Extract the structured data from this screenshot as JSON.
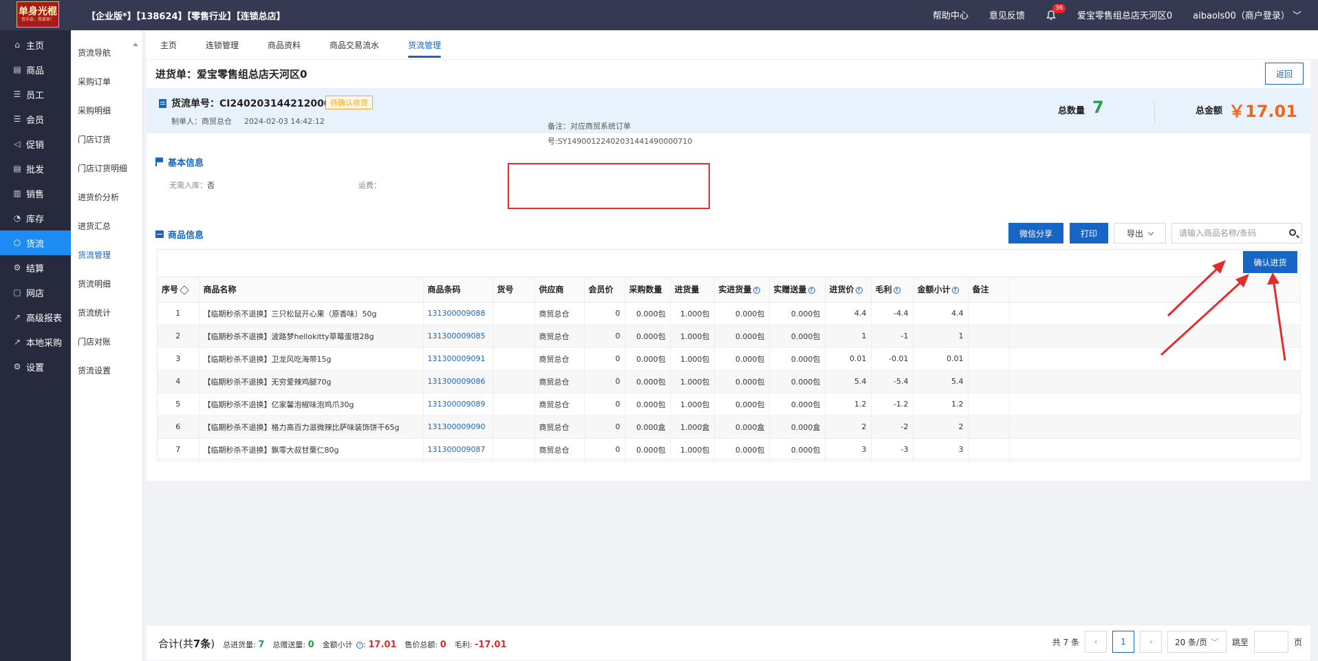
{
  "topbar": {
    "logo_text": "单身光棍",
    "logo_sub": "音乐会，我爱家！",
    "title": "【企业版*】【138624】【零售行业】【连锁总店】",
    "help": "帮助中心",
    "feedback": "意见反馈",
    "notifications": "36",
    "store": "爱宝零售组总店天河区0",
    "user": "aibaols00（商户登录）"
  },
  "leftnav": {
    "items": [
      {
        "label": "主页",
        "icon": "home-icon",
        "glyph": "⌂"
      },
      {
        "label": "商品",
        "icon": "product-icon",
        "glyph": "▤"
      },
      {
        "label": "员工",
        "icon": "staff-icon",
        "glyph": "☰"
      },
      {
        "label": "会员",
        "icon": "member-icon",
        "glyph": "☰"
      },
      {
        "label": "促销",
        "icon": "promotion-icon",
        "glyph": "◁"
      },
      {
        "label": "批发",
        "icon": "wholesale-icon",
        "glyph": "▤"
      },
      {
        "label": "销售",
        "icon": "sales-icon",
        "glyph": "▥"
      },
      {
        "label": "库存",
        "icon": "inventory-icon",
        "glyph": "◔"
      },
      {
        "label": "货流",
        "icon": "goods-flow-icon",
        "glyph": "⬡"
      },
      {
        "label": "结算",
        "icon": "settlement-icon",
        "glyph": "⚙"
      },
      {
        "label": "网店",
        "icon": "online-store-icon",
        "glyph": "▢"
      },
      {
        "label": "高级报表",
        "icon": "report-icon",
        "glyph": "↗"
      },
      {
        "label": "本地采购",
        "icon": "local-purchase-icon",
        "glyph": "↗"
      },
      {
        "label": "设置",
        "icon": "settings-icon",
        "glyph": "⚙"
      }
    ],
    "active_index": 8
  },
  "subnav": {
    "items": [
      "货流导航",
      "采购订单",
      "采购明细",
      "门店订货",
      "门店订货明细",
      "进货价分析",
      "进货汇总",
      "货流管理",
      "货流明细",
      "货流统计",
      "门店对账",
      "货流设置"
    ],
    "active_index": 7
  },
  "tabs": {
    "items": [
      "主页",
      "连锁管理",
      "商品资料",
      "商品交易流水",
      "货流管理"
    ],
    "active_index": 4
  },
  "page": {
    "title": "进货单：爱宝零售组总店天河区0",
    "back": "返回"
  },
  "summary": {
    "doc_no": "货流单号：CI24020314421200073",
    "status": "待确认收货",
    "creator": "制单人：商贸总仓",
    "created_at": "2024-02-03 14:42:12",
    "total_qty_label": "总数量",
    "total_qty": "7",
    "total_amt_label": "总金额",
    "total_amt": "￥17.01"
  },
  "basic": {
    "title": "基本信息",
    "no_stock_label": "无需入库：",
    "no_stock_value": "否",
    "freight_label": "运费：",
    "remark_line1": "备注：对应商贸系统订单",
    "remark_line2": "号:SY149001224020314414900007​10"
  },
  "goods": {
    "title": "商品信息",
    "wechat_share": "微信分享",
    "print": "打印",
    "export": "导出",
    "search_placeholder": "请输入商品名称/条码",
    "confirm": "确认进货"
  },
  "table": {
    "columns": [
      "序号",
      "商品名称",
      "商品条码",
      "货号",
      "供应商",
      "会员价",
      "采购数量",
      "进货量",
      "实进货量",
      "实赠送量",
      "进货价",
      "毛利",
      "金额小计",
      "备注"
    ],
    "rows": [
      {
        "no": "1",
        "name": "【临期秒杀不退换】三只松鼠开心果（原香味）50g",
        "barcode": "131300009088",
        "sku": "",
        "supplier": "商贸总仓",
        "member_price": "0",
        "purchase_qty": "0.000包",
        "in_qty": "1.000包",
        "actual_qty": "0.000包",
        "gift_qty": "0.000包",
        "price": "4.4",
        "profit": "-4.4",
        "subtotal": "4.4",
        "note": ""
      },
      {
        "no": "2",
        "name": "【临期秒杀不退换】波路梦hellokitty草莓蛋塔28g",
        "barcode": "131300009085",
        "sku": "",
        "supplier": "商贸总仓",
        "member_price": "0",
        "purchase_qty": "0.000包",
        "in_qty": "1.000包",
        "actual_qty": "0.000包",
        "gift_qty": "0.000包",
        "price": "1",
        "profit": "-1",
        "subtotal": "1",
        "note": ""
      },
      {
        "no": "3",
        "name": "【临期秒杀不退换】卫龙风吃海带15g",
        "barcode": "131300009091",
        "sku": "",
        "supplier": "商贸总仓",
        "member_price": "0",
        "purchase_qty": "0.000包",
        "in_qty": "1.000包",
        "actual_qty": "0.000包",
        "gift_qty": "0.000包",
        "price": "0.01",
        "profit": "-0.01",
        "subtotal": "0.01",
        "note": ""
      },
      {
        "no": "4",
        "name": "【临期秒杀不退换】无穷爱辣鸡腿70g",
        "barcode": "131300009086",
        "sku": "",
        "supplier": "商贸总仓",
        "member_price": "0",
        "purchase_qty": "0.000包",
        "in_qty": "1.000包",
        "actual_qty": "0.000包",
        "gift_qty": "0.000包",
        "price": "5.4",
        "profit": "-5.4",
        "subtotal": "5.4",
        "note": ""
      },
      {
        "no": "5",
        "name": "【临期秒杀不退换】亿家馨泡椒味泡鸡爪30g",
        "barcode": "131300009089",
        "sku": "",
        "supplier": "商贸总仓",
        "member_price": "0",
        "purchase_qty": "0.000包",
        "in_qty": "1.000包",
        "actual_qty": "0.000包",
        "gift_qty": "0.000包",
        "price": "1.2",
        "profit": "-1.2",
        "subtotal": "1.2",
        "note": ""
      },
      {
        "no": "6",
        "name": "【临期秒杀不退换】格力高百力滋微辣比萨味装饰饼干65g",
        "barcode": "131300009090",
        "sku": "",
        "supplier": "商贸总仓",
        "member_price": "0",
        "purchase_qty": "0.000盒",
        "in_qty": "1.000盒",
        "actual_qty": "0.000盒",
        "gift_qty": "0.000盒",
        "price": "2",
        "profit": "-2",
        "subtotal": "2",
        "note": ""
      },
      {
        "no": "7",
        "name": "【临期秒杀不退换】飘零大叔甘栗仁80g",
        "barcode": "131300009087",
        "sku": "",
        "supplier": "商贸总仓",
        "member_price": "0",
        "purchase_qty": "0.000包",
        "in_qty": "1.000包",
        "actual_qty": "0.000包",
        "gift_qty": "0.000包",
        "price": "3",
        "profit": "-3",
        "subtotal": "3",
        "note": ""
      }
    ]
  },
  "footer": {
    "total_label": "合计(共",
    "total_count": "7条",
    "total_close": ")",
    "in_qty_label": "总进货量:",
    "in_qty": "7",
    "gift_label": "总赠送量:",
    "gift": "0",
    "subtotal_label": "金额小计",
    "subtotal": "17.01",
    "sale_label": "售价总额:",
    "sale": "0",
    "profit_label": "毛利:",
    "profit": "-17.01",
    "count_text": "共 7 条",
    "page": "1",
    "page_size": "20 条/页",
    "jump_label": "跳至",
    "page_unit": "页"
  },
  "colors": {
    "topbar": "#353a52",
    "sidebar": "#262a3c",
    "accent": "#1766c6",
    "nav_active": "#1e8bf3",
    "green": "#21a148",
    "orange": "#f5641e",
    "annotation_red": "#e52a2a"
  }
}
